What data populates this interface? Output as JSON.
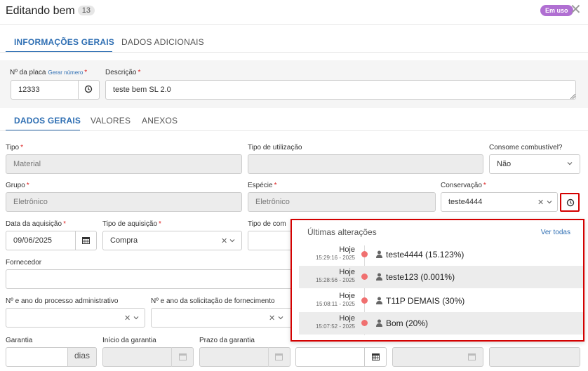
{
  "header": {
    "title": "Editando bem",
    "count": "13",
    "status_badge": "Em uso",
    "close": "✕"
  },
  "main_tabs": [
    {
      "label": "INFORMAÇÕES GERAIS"
    },
    {
      "label": "DADOS ADICIONAIS"
    }
  ],
  "placa": {
    "label": "Nº da placa",
    "generate_link": "Gerar número",
    "value": "12333"
  },
  "descricao": {
    "label": "Descrição",
    "value": "teste bem SL 2.0"
  },
  "sub_tabs": [
    {
      "label": "DADOS GERAIS"
    },
    {
      "label": "VALORES"
    },
    {
      "label": "ANEXOS"
    }
  ],
  "fields": {
    "tipo": {
      "label": "Tipo",
      "value": "Material"
    },
    "tipo_utilizacao": {
      "label": "Tipo de utilização",
      "value": ""
    },
    "consome": {
      "label": "Consome combustível?",
      "value": "Não"
    },
    "grupo": {
      "label": "Grupo",
      "value": "Eletrônico"
    },
    "especie": {
      "label": "Espécie",
      "value": "Eletrônico"
    },
    "conservacao": {
      "label": "Conservação",
      "value": "teste4444"
    },
    "data_aquisicao": {
      "label": "Data da aquisição",
      "value": "09/06/2025"
    },
    "tipo_aquisicao": {
      "label": "Tipo de aquisição",
      "value": "Compra"
    },
    "tipo_com": {
      "label": "Tipo de com"
    },
    "fornecedor": {
      "label": "Fornecedor",
      "value": ""
    },
    "processo": {
      "label": "Nº e ano do processo administrativo"
    },
    "solicitacao": {
      "label": "Nº e ano da solicitação de fornecimento"
    },
    "garantia": {
      "label": "Garantia",
      "suffix": "dias"
    },
    "inicio_garantia": {
      "label": "Início da garantia"
    },
    "prazo_garantia": {
      "label": "Prazo da garantia"
    }
  },
  "history_popup": {
    "title": "Últimas alterações",
    "view_all": "Ver todas",
    "items": [
      {
        "day": "Hoje",
        "time": "15:29:16 - 2025",
        "text": "teste4444 (15.123%)"
      },
      {
        "day": "Hoje",
        "time": "15:28:56 - 2025",
        "text": "teste123 (0.001%)"
      },
      {
        "day": "Hoje",
        "time": "15:08:11 - 2025",
        "text": "T11P DEMAIS (30%)"
      },
      {
        "day": "Hoje",
        "time": "15:07:52 - 2025",
        "text": "Bom (20%)"
      }
    ]
  },
  "colors": {
    "accent": "#2f6fb3",
    "required": "#dd2222",
    "highlight_border": "#d40000",
    "badge": "#b06fd2",
    "timeline_dot": "#f07070"
  }
}
